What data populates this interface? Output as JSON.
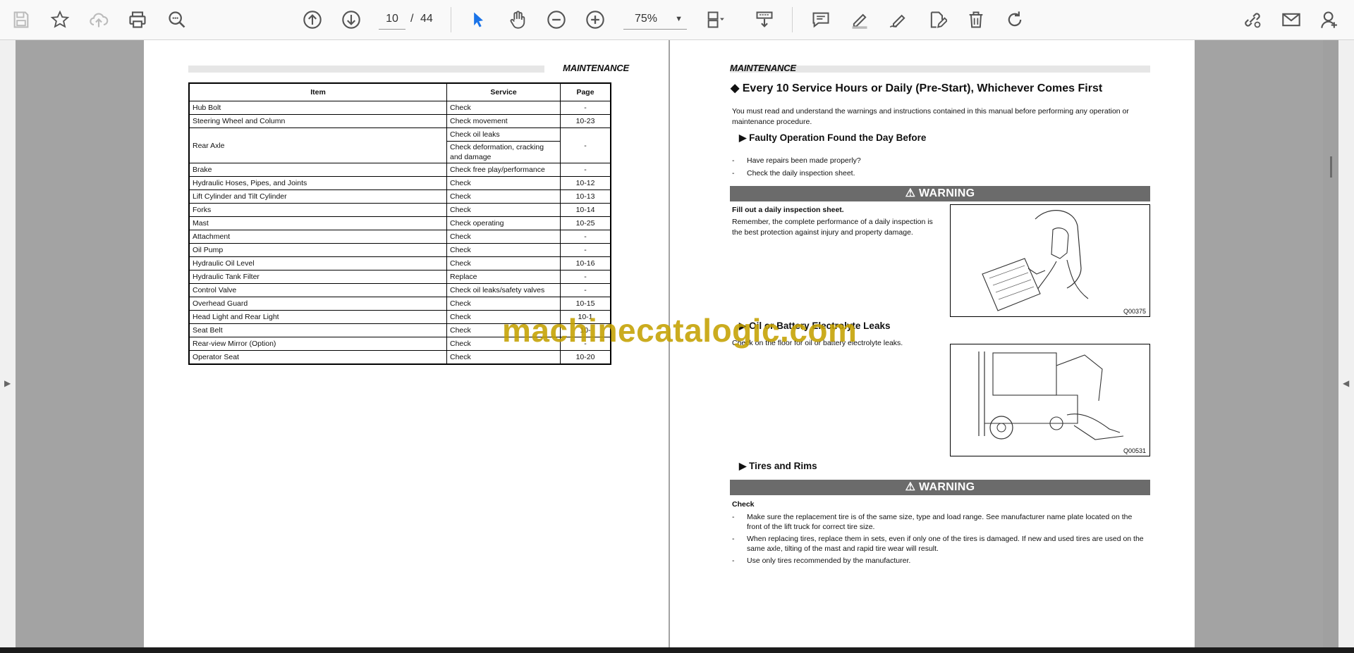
{
  "toolbar": {
    "page_current": "10",
    "page_separator": "/",
    "page_total": "44",
    "zoom": "75%",
    "zoom_caret": "▼"
  },
  "left_page": {
    "header": "MAINTENANCE",
    "table": {
      "headers": [
        "Item",
        "Service",
        "Page"
      ],
      "rows": [
        {
          "item": "Hub Bolt",
          "services": [
            "Check"
          ],
          "page": "-"
        },
        {
          "item": "Steering Wheel and Column",
          "services": [
            "Check movement"
          ],
          "page": "10-23"
        },
        {
          "item": "Rear Axle",
          "services": [
            "Check oil leaks",
            "Check deformation, cracking and damage"
          ],
          "page": "-"
        },
        {
          "item": "Brake",
          "services": [
            "Check free play/performance"
          ],
          "page": "-"
        },
        {
          "item": "Hydraulic Hoses, Pipes, and Joints",
          "services": [
            "Check"
          ],
          "page": "10-12"
        },
        {
          "item": "Lift Cylinder and Tilt Cylinder",
          "services": [
            "Check"
          ],
          "page": "10-13"
        },
        {
          "item": "Forks",
          "services": [
            "Check"
          ],
          "page": "10-14"
        },
        {
          "item": "Mast",
          "services": [
            "Check operating"
          ],
          "page": "10-25"
        },
        {
          "item": "Attachment",
          "services": [
            "Check"
          ],
          "page": "-"
        },
        {
          "item": "Oil Pump",
          "services": [
            "Check"
          ],
          "page": "-"
        },
        {
          "item": "Hydraulic Oil Level",
          "services": [
            "Check"
          ],
          "page": "10-16"
        },
        {
          "item": "Hydraulic Tank Filter",
          "services": [
            "Replace"
          ],
          "page": "-"
        },
        {
          "item": "Control Valve",
          "services": [
            "Check oil leaks/safety valves"
          ],
          "page": "-"
        },
        {
          "item": "Overhead Guard",
          "services": [
            "Check"
          ],
          "page": "10-15"
        },
        {
          "item": "Head Light and Rear Light",
          "services": [
            "Check"
          ],
          "page": "10-1"
        },
        {
          "item": "Seat Belt",
          "services": [
            "Check"
          ],
          "page": "10-"
        },
        {
          "item": "Rear-view Mirror (Option)",
          "services": [
            "Check"
          ],
          "page": "-"
        },
        {
          "item": "Operator Seat",
          "services": [
            "Check"
          ],
          "page": "10-20"
        }
      ]
    }
  },
  "right_page": {
    "header": "MAINTENANCE",
    "title": "◆ Every 10 Service Hours or Daily (Pre-Start), Whichever Comes First",
    "intro": "You must read and understand the warnings and instructions contained in this manual before performing any operation or maintenance procedure.",
    "section1": {
      "heading": "▶ Faulty Operation Found the Day Before",
      "bullets": [
        "Have repairs been made properly?",
        "Check the daily inspection sheet."
      ]
    },
    "warning_label": "⚠ WARNING",
    "warning1": {
      "bold": "Fill out a daily inspection sheet.",
      "text": "Remember, the complete performance of a daily inspection is the best protection against injury and property damage.",
      "fig_code": "Q00375"
    },
    "section2": {
      "heading": "▶ Oil or Battery Electrolyte Leaks",
      "text": "Check on the floor for oil or battery electrolyte leaks.",
      "fig_code": "Q00531"
    },
    "section3": {
      "heading": "▶ Tires and Rims"
    },
    "warning2": {
      "bold": "Check",
      "bullets": [
        "Make sure the replacement tire is of the same size, type and load range. See manufacturer name plate located on the front of the lift truck for correct tire size.",
        "When replacing tires, replace them in sets, even if only one of the tires is damaged. If new and used tires are used on the same axle, tilting of the mast and rapid tire wear will result.",
        "Use only tires recommended by the manufacturer."
      ]
    },
    "dash": "-"
  },
  "watermark": "machinecatalogic.com",
  "nav": {
    "left_arrow": "◀",
    "right_arrow": "◀"
  }
}
